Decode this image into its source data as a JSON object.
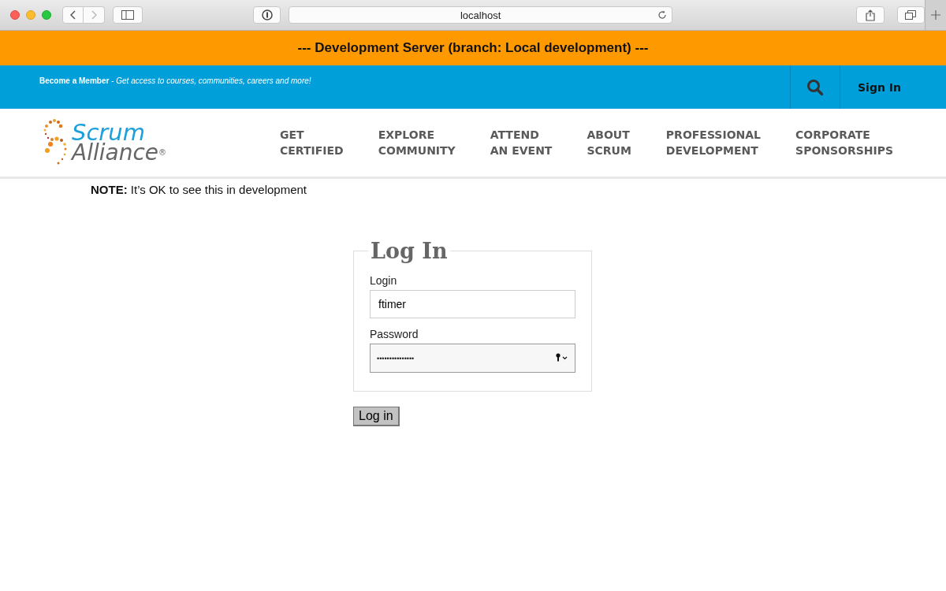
{
  "browser": {
    "url": "localhost"
  },
  "dev_banner": "--- Development Server (branch: Local development) ---",
  "member_bar": {
    "promo": "**Become a Member** - *Get access to courses, communities, careers and more!*",
    "sign_in": "Sign In"
  },
  "logo": {
    "line_1": "Scrum",
    "line_2": "Alliance",
    "mark": "®"
  },
  "nav": [
    {
      "label": "GET\nCERTIFIED"
    },
    {
      "label": "EXPLORE\nCOMMUNITY"
    },
    {
      "label": "ATTEND\nAN EVENT"
    },
    {
      "label": "ABOUT\nSCRUM"
    },
    {
      "label": "PROFESSIONAL\nDEVELOPMENT"
    },
    {
      "label": "CORPORATE\nSPONSORSHIPS"
    }
  ],
  "note": "**NOTE:** It’s OK to see this in development",
  "login_form": {
    "title": "Log In",
    "fields": [
      {
        "label": "Login",
        "value": "ftimer",
        "kind": "text"
      },
      {
        "label": "Password",
        "value": "•••••••••••••••",
        "kind": "password"
      }
    ],
    "submit": "Log in"
  }
}
